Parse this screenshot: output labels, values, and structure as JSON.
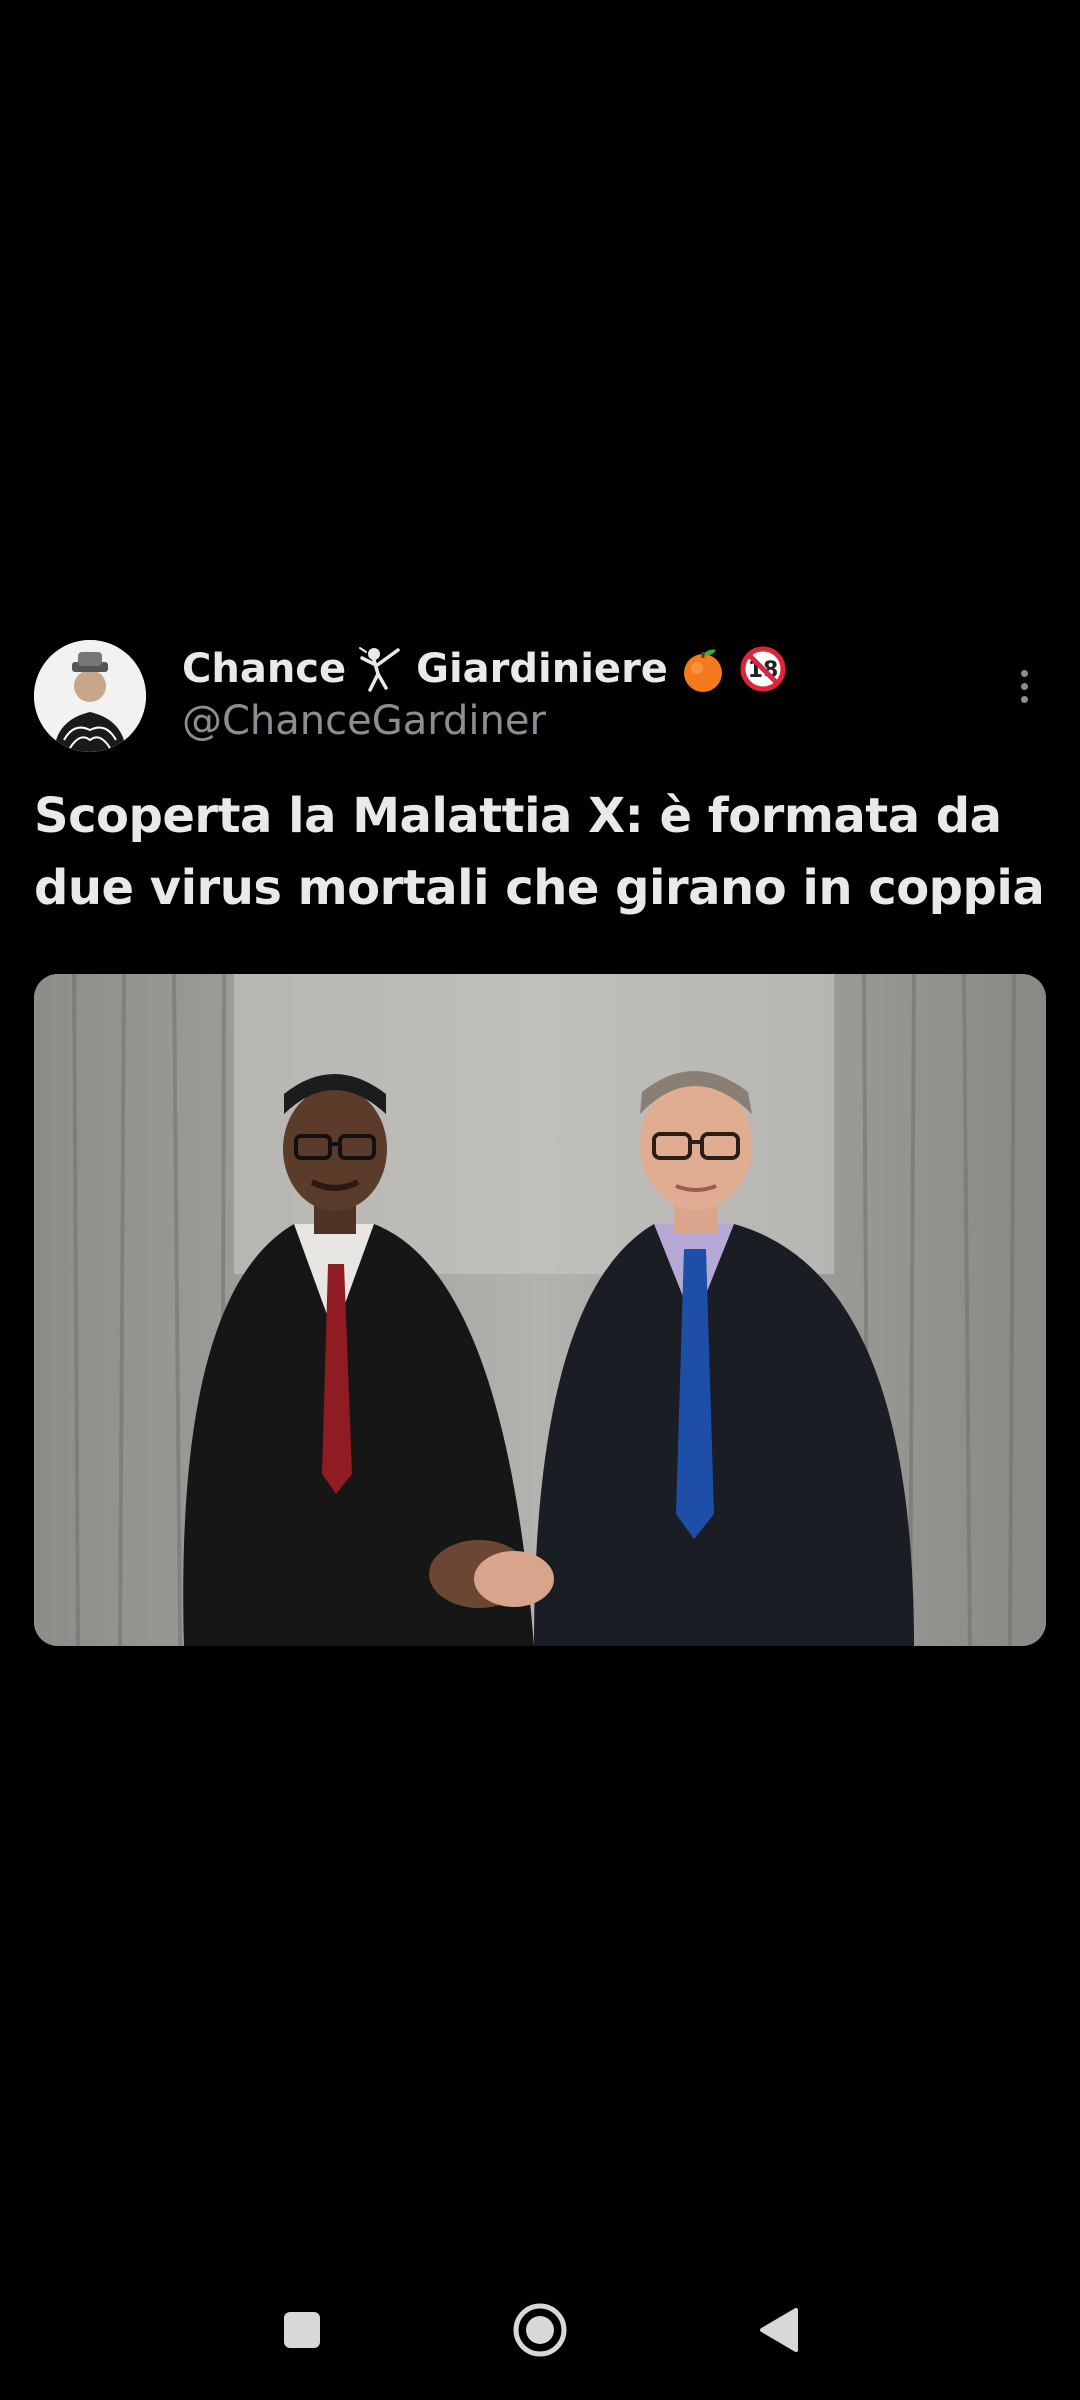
{
  "tweet": {
    "display_name": "Chance",
    "display_name_suffix": "Giardiniere",
    "name_icons": [
      "fencer-emoji-icon",
      "tangerine-emoji-icon",
      "no-under-18-emoji-icon"
    ],
    "handle": "@ChanceGardiner",
    "text": "Scoperta la Malattia X: è formata da due virus mortali che girano in coppia",
    "menu_icon": "more-vertical-icon",
    "media_description_icon": "photo-image"
  },
  "nav_bar": {
    "recents_icon": "square-icon",
    "home_icon": "circle-home-icon",
    "back_icon": "triangle-back-icon"
  },
  "colors": {
    "background": "#000000",
    "primary_text": "#e7e9ea",
    "secondary_text": "#8b8f93"
  }
}
